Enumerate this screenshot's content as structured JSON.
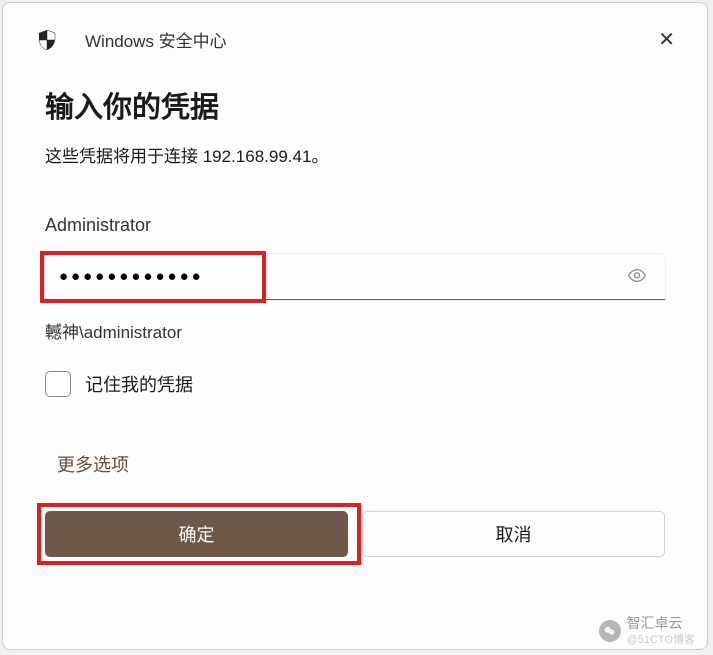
{
  "header": {
    "title": "Windows 安全中心",
    "close": "✕"
  },
  "main": {
    "title": "输入你的凭据",
    "subtitle": "这些凭据将用于连接 192.168.99.41。",
    "username": "Administrator",
    "password_value": "●●●●●●●●●●●●",
    "domain_user": "轗神\\administrator",
    "remember_label": "记住我的凭据",
    "more_options": "更多选项"
  },
  "buttons": {
    "ok": "确定",
    "cancel": "取消"
  },
  "watermark": {
    "main": "智汇卓云",
    "sub": "@51CTO博客"
  }
}
